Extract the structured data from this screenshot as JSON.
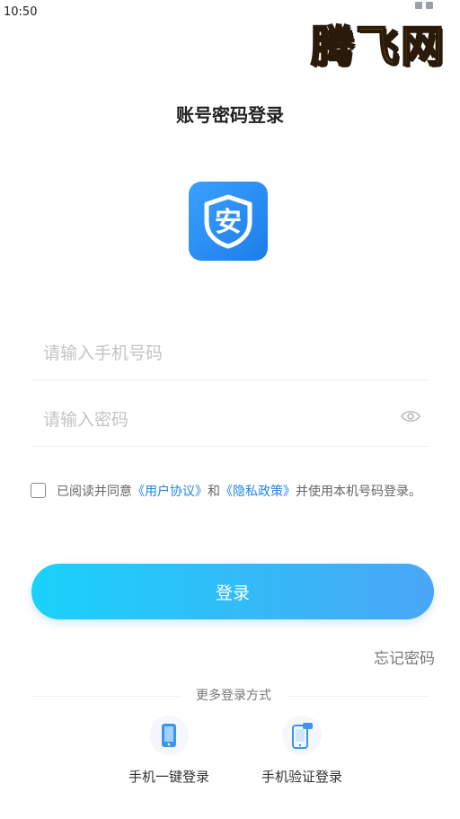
{
  "status_bar": {
    "time": "10:50"
  },
  "watermark": "腾飞网",
  "page_title": "账号密码登录",
  "logo": {
    "icon": "shield-an-icon",
    "glyph": "安",
    "color": "#2a8cf0"
  },
  "form": {
    "phone_placeholder": "请输入手机号码",
    "password_placeholder": "请输入密码"
  },
  "agreement": {
    "prefix": "已阅读并同意",
    "user_agreement": "《用户协议》",
    "and": "和",
    "privacy_policy": "《隐私政策》",
    "suffix": "并使用本机号码登录。"
  },
  "login_button": "登录",
  "forgot_password": "忘记密码",
  "more_login_methods": "更多登录方式",
  "alt_methods": [
    {
      "label": "手机一键登录",
      "icon": "phone-icon"
    },
    {
      "label": "手机验证登录",
      "icon": "phone-sms-icon"
    }
  ],
  "colors": {
    "accent": "#1e88e5",
    "button_start": "#19d2fa",
    "button_end": "#4aa6f5"
  }
}
